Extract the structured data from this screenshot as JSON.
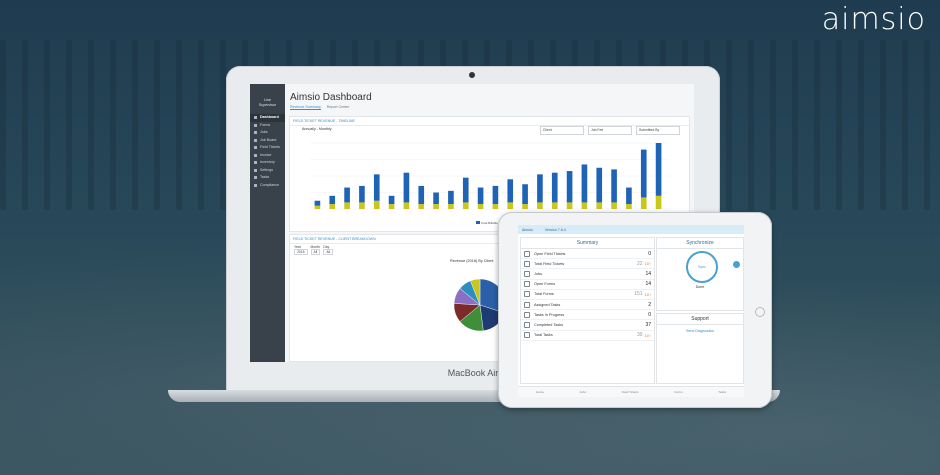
{
  "brand": {
    "logo_text": "aimsio"
  },
  "laptop": {
    "model_label": "MacBook Air"
  },
  "dashboard": {
    "title": "Aimsio Dashboard",
    "sidebar": {
      "user_line1": "Line",
      "user_line2": "Supervisor",
      "items": [
        "Dashboard",
        "Forms",
        "Jobs",
        "Job Board",
        "Field Tickets",
        "Invoice",
        "Inventory",
        "Settings",
        "Tasks",
        "Compliance"
      ]
    },
    "tabs": [
      "Revenue Summary",
      "Report Center"
    ],
    "panel1": {
      "header": "FIELD TICKET REVENUE - TIMELINE",
      "subtitle": "Annually - Monthly",
      "filters": [
        "Client",
        "Job Fee",
        "Submitted By"
      ],
      "legend": [
        "Total Billable",
        "Total Non"
      ]
    },
    "panel2": {
      "header": "FIELD TICKET REVENUE - CLIENT BREAKDOWN",
      "fields": [
        {
          "label": "Year",
          "value": "2018"
        },
        {
          "label": "Month",
          "value": "All"
        },
        {
          "label": "Day",
          "value": "All"
        }
      ],
      "pie_title": "Revenue (2018) By Client"
    },
    "colors": {
      "accent": "#2f8fcf",
      "bar_primary": "#1f63b6",
      "bar_secondary": "#c9c61c",
      "sidebar": "#39424b"
    }
  },
  "chart_data": [
    {
      "type": "bar",
      "series": [
        {
          "name": "Total Billable",
          "values": [
            6,
            10,
            18,
            20,
            32,
            10,
            36,
            22,
            14,
            16,
            30,
            20,
            22,
            28,
            24,
            34,
            36,
            38,
            46,
            42,
            40,
            20,
            58,
            64
          ]
        },
        {
          "name": "Total Non",
          "values": [
            4,
            6,
            8,
            8,
            10,
            6,
            8,
            6,
            6,
            6,
            8,
            6,
            6,
            8,
            6,
            8,
            8,
            8,
            8,
            8,
            8,
            6,
            14,
            16
          ]
        }
      ]
    },
    {
      "type": "pie",
      "title": "Revenue (2018) By Client",
      "values": [
        30,
        18,
        16,
        12,
        10,
        8,
        6
      ]
    }
  ],
  "tablet": {
    "app_name": "Aimsio",
    "version": "Version 7.6.4",
    "summary_title": "Summary",
    "rows": [
      {
        "label": "Open Field Tickets",
        "value": "0",
        "change": ""
      },
      {
        "label": "Total Field Tickets",
        "value": "22",
        "change": "10"
      },
      {
        "label": "Jobs",
        "value": "14",
        "change": ""
      },
      {
        "label": "Open Forms",
        "value": "14",
        "change": ""
      },
      {
        "label": "Total Forms",
        "value": "151",
        "change": "10"
      },
      {
        "label": "Assigned Tasks",
        "value": "2",
        "change": ""
      },
      {
        "label": "Tasks In Progress",
        "value": "0",
        "change": ""
      },
      {
        "label": "Completed Tasks",
        "value": "37",
        "change": ""
      },
      {
        "label": "Total Tasks",
        "value": "39",
        "change": "10"
      }
    ],
    "sync_title": "Synchronize",
    "sync_button": "Sync",
    "sync_status": "Done",
    "support_title": "Support",
    "support_link": "Send Diagnostics",
    "bottom_nav": [
      "Home",
      "Jobs",
      "Field Tickets",
      "Forms",
      "Tasks"
    ]
  }
}
